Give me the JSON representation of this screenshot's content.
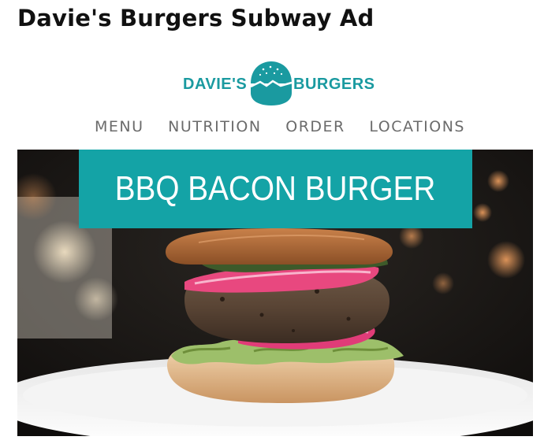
{
  "page": {
    "title": "Davie's Burgers Subway Ad"
  },
  "logo": {
    "left_word": "DAVIE'S",
    "right_word": "BURGERS",
    "icon": "burger-logo-icon",
    "brand_color": "#1a9aa0"
  },
  "nav": {
    "items": [
      {
        "label": "MENU"
      },
      {
        "label": "NUTRITION"
      },
      {
        "label": "ORDER"
      },
      {
        "label": "LOCATIONS"
      }
    ]
  },
  "hero": {
    "banner_text": "BBQ BACON BURGER",
    "banner_color": "#14a3a6",
    "image": "burger-photo"
  }
}
